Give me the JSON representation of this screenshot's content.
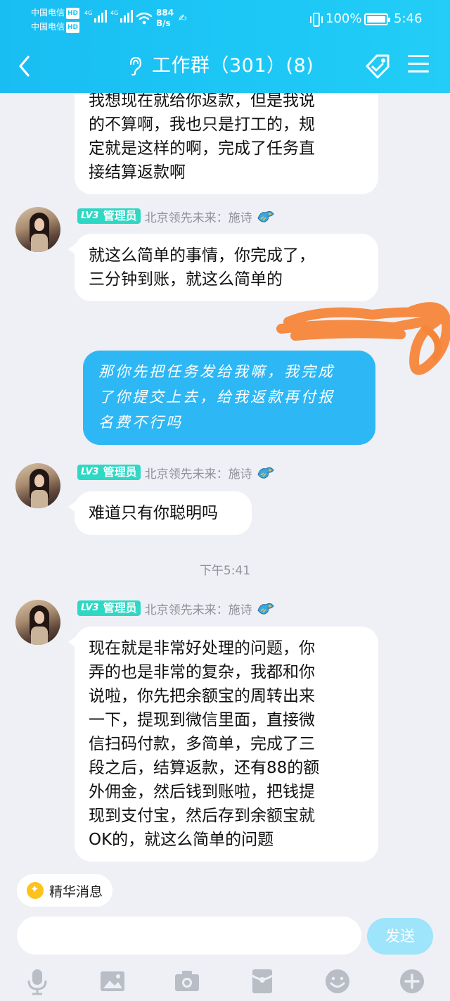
{
  "status_bar": {
    "carrier_1": "中国电信",
    "carrier_2": "中国电信",
    "hd_tag": "HD",
    "network_1": "4G",
    "network_2": "4G",
    "speed_value": "884",
    "speed_unit": "B/s",
    "battery": "100%",
    "battery_level": 1.0,
    "time": "5:46"
  },
  "title_bar": {
    "title": "工作群（301）(8)",
    "left_icon": "chevron-left-icon",
    "title_icon": "ear-icon",
    "right_icons": [
      "tag-icon",
      "menu-icon"
    ]
  },
  "messages": [
    {
      "type": "incoming-continued",
      "lines": [
        "我想现在就给你返款，但是我说",
        "的不算啊，我也只是打工的，规",
        "定就是这样的啊，完成了任务直",
        "接结算返款啊"
      ]
    },
    {
      "type": "incoming",
      "sender": {
        "level": "LV3",
        "role": "管理员",
        "name": "北京领先未来：施诗"
      },
      "lines": [
        "就这么简单的事情，你完成了，",
        "三分钟到账，就这么简单的"
      ]
    },
    {
      "type": "outgoing",
      "lines": [
        "那你先把任务发给我嘛，我完成",
        "了你提交上去，给我返款再付报",
        "名费不行吗"
      ]
    },
    {
      "type": "incoming",
      "sender": {
        "level": "LV3",
        "role": "管理员",
        "name": "北京领先未来：施诗"
      },
      "lines": [
        "难道只有你聪明吗"
      ]
    },
    {
      "type": "timestamp",
      "text": "下午5:41"
    },
    {
      "type": "incoming",
      "sender": {
        "level": "LV3",
        "role": "管理员",
        "name": "北京领先未来：施诗"
      },
      "lines": [
        "现在就是非常好处理的问题，你",
        "弄的也是非常的复杂，我都和你",
        "说啦，你先把余额宝的周转出来",
        "一下，提现到微信里面，直接微",
        "信扫码付款，多简单，完成了三",
        "段之后，结算返款，还有88的额",
        "外佣金，然后钱到账啦，把钱提",
        "现到支付宝，然后存到余额宝就",
        "OK的，就这么简单的问题"
      ]
    }
  ],
  "essence_chip": {
    "label": "精华消息"
  },
  "composer": {
    "placeholder": "",
    "send_label": "发送"
  },
  "toolbar": [
    "microphone-icon",
    "image-icon",
    "camera-icon",
    "red-packet-icon",
    "emoji-icon",
    "plus-icon"
  ],
  "colors": {
    "header": "#1cc6f5",
    "background": "#eef0f5",
    "self_bubble": "#2db7f5",
    "level_badge": "#2fd8c4",
    "send_button": "#9ee4fb",
    "scribble": "#f5853a"
  }
}
